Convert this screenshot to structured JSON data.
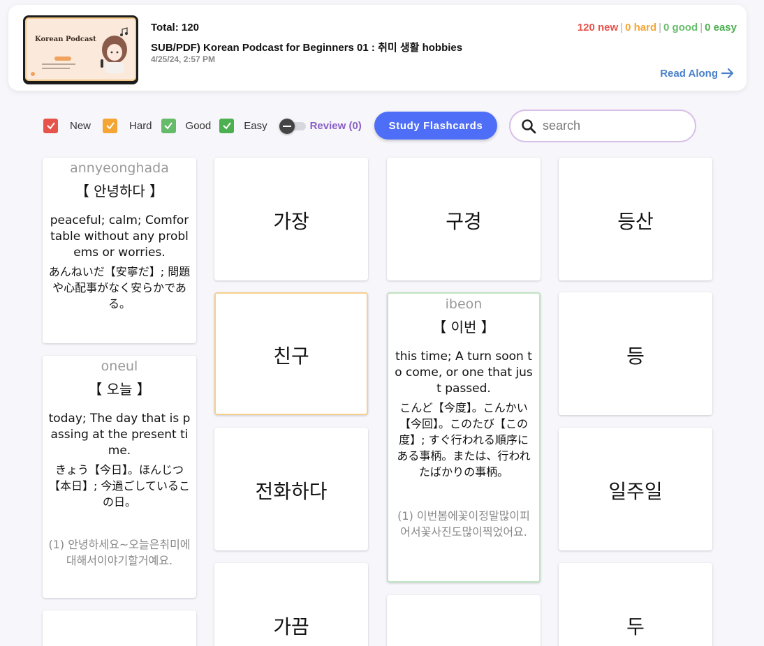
{
  "header": {
    "thumbnail_title": "Korean Podcast",
    "total": "Total: 120",
    "title": "SUB/PDF) Korean Podcast for Beginners 01 : 취미 생활 hobbies",
    "date": "4/25/24, 2:57 PM",
    "counts": {
      "new": "120 new",
      "hard": "0 hard",
      "good": "0 good",
      "easy": "0 easy",
      "separator": "|"
    },
    "read_along": "Read Along",
    "colors": {
      "new": "#e5534b",
      "hard": "#f4a533",
      "good": "#66bb6a",
      "easy": "#4caf50"
    }
  },
  "filters": {
    "new": {
      "label": "New",
      "checked": true,
      "color": "#e5534b"
    },
    "hard": {
      "label": "Hard",
      "checked": true,
      "color": "#f4a533"
    },
    "good": {
      "label": "Good",
      "checked": true,
      "color": "#66bb6a"
    },
    "easy": {
      "label": "Easy",
      "checked": true,
      "color": "#4caf50"
    },
    "review": {
      "label": "Review (0)",
      "on": false
    }
  },
  "study_button": "Study Flashcards",
  "search": {
    "placeholder": "search",
    "value": ""
  },
  "cards": {
    "c1": {
      "romanization": "annyeonghada",
      "hangul": "【 안녕하다 】",
      "english": "peaceful; calm; Comfortable without any problems or worries.",
      "japanese": "あんねいだ【安寧だ】; 問題や心配事がなく安らかである。"
    },
    "c2": {
      "romanization": "oneul",
      "hangul": "【 오늘 】",
      "english": "today; The day that is passing at the present time.",
      "japanese": "きょう【今日】。ほんじつ【本日】; 今過ごしているこの日。",
      "example": "(1) 안녕하세요~오늘은취미에대해서이야기할거예요."
    },
    "c4": {
      "word": "가장"
    },
    "c5": {
      "word": "친구"
    },
    "c6": {
      "word": "전화하다"
    },
    "c7": {
      "word": "가끔"
    },
    "c8": {
      "word": "구경"
    },
    "c9": {
      "romanization": "ibeon",
      "hangul": "【 이번 】",
      "english": "this time; A turn soon to come, or one that just passed.",
      "japanese": "こんど【今度】。こんかい【今回】。このたび【この度】; すぐ行われる順序にある事柄。または、行われたばかりの事柄。",
      "example": "(1) 이번봄에꽃이정말많이피어서꽃사진도많이찍었어요."
    },
    "c11": {
      "word": "등산"
    },
    "c12": {
      "word": "등"
    },
    "c13": {
      "word": "일주일"
    },
    "c14": {
      "word": "두"
    }
  }
}
